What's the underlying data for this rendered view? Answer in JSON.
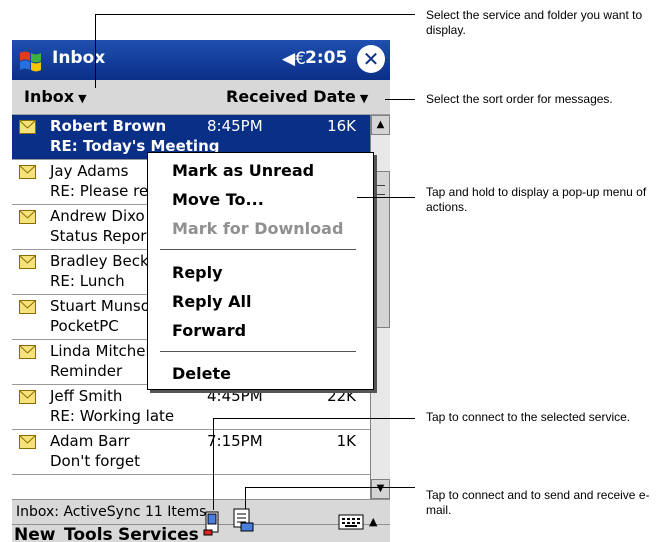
{
  "titlebar": {
    "app_title": "Inbox",
    "clock": "2:05",
    "speaker_glyph": "◀€",
    "close_glyph": "✕"
  },
  "toolbar": {
    "folder_label": "Inbox",
    "sort_label": "Received Date"
  },
  "messages": [
    {
      "sender": "Robert Brown",
      "subject": "RE: Today's Meeting",
      "time": "8:45PM",
      "size": "16K"
    },
    {
      "sender": "Jay Adams",
      "subject": "RE: Please re",
      "time": "",
      "size": ""
    },
    {
      "sender": "Andrew Dixo",
      "subject": "Status Repor",
      "time": "",
      "size": ""
    },
    {
      "sender": "Bradley Beck",
      "subject": "RE: Lunch",
      "time": "",
      "size": ""
    },
    {
      "sender": "Stuart Munso",
      "subject": "PocketPC",
      "time": "",
      "size": ""
    },
    {
      "sender": "Linda Mitchel",
      "subject": "Reminder",
      "time": "",
      "size": ""
    },
    {
      "sender": "Jeff Smith",
      "subject": "RE: Working late",
      "time": "4:45PM",
      "size": "22K"
    },
    {
      "sender": "Adam Barr",
      "subject": "Don't forget",
      "time": "7:15PM",
      "size": "1K"
    }
  ],
  "popup_menu": {
    "items": [
      "Mark as Unread",
      "Move To...",
      "Mark for Download",
      "Reply",
      "Reply All",
      "Forward",
      "Delete"
    ]
  },
  "status_bar": "Inbox: ActiveSync  11 Items.",
  "menubar": {
    "new": "New",
    "tools": "Tools",
    "services": "Services"
  },
  "callouts": {
    "service": "Select the service and folder you want to display.",
    "sort": "Select the sort order for messages.",
    "hold": "Tap and hold to display a pop-up menu of actions.",
    "connect": "Tap to connect to the selected service.",
    "send_receive": "Tap to connect and to send and receive e-mail."
  },
  "colors": {
    "title_bg": "#0a2f87",
    "selection": "#0a2f87",
    "bar_gray": "#d8d8d8"
  }
}
